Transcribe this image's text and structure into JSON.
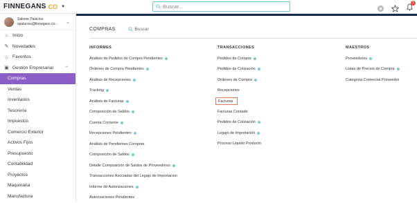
{
  "topbar": {
    "logo_text": "FINNEGANS",
    "logo_co": "CO",
    "search_placeholder": "Buscar...",
    "notifications_count": "1",
    "colors": {
      "search_border": "#6fc3d8",
      "badge": "#e74c3c"
    }
  },
  "user": {
    "name": "Salome Palacios",
    "email": "spalacios@finnegans.co..."
  },
  "sidebar": {
    "items": [
      {
        "label": "Inicio",
        "icon": "home-icon"
      },
      {
        "label": "Novedades",
        "icon": "pin-icon"
      },
      {
        "label": "Favoritos",
        "icon": "star-icon"
      },
      {
        "label": "Gestión Empresarial",
        "icon": "briefcase-icon"
      }
    ],
    "sub_items": [
      "Compras",
      "Ventas",
      "Inventarios",
      "Tesorería",
      "Impuestos",
      "Comercio Exterior",
      "Activos Fijos",
      "Presupuesto",
      "Contabilidad",
      "Proyectos",
      "Maquinaria",
      "Manufactura"
    ],
    "active": "Compras",
    "colors": {
      "active_bg": "#8b5fc7",
      "top_band": "#1b2a4a"
    }
  },
  "main": {
    "title": "COMPRAS",
    "search_label": "Buscar",
    "columns": [
      {
        "title": "INFORMES",
        "links": [
          "Análisis de Pedidos de Compra Pendientes",
          "Órdenes de Compra Pendientes",
          "Análisis de Recepciones",
          "Tracking",
          "Análisis de Facturas",
          "Composición de Saldos",
          "Cuenta Corriente",
          "Recepciones Pendientes",
          "Análisis de Pendientes Compras",
          "Composición de Saldos",
          "Detalle Composición de Saldos de Proveedores",
          "Transacciones Asociadas del Legajo de Importacion",
          "Informe de Autorizaciones",
          "Autorizaciones Pendientes"
        ],
        "info_flags": [
          true,
          true,
          true,
          true,
          true,
          true,
          true,
          true,
          false,
          true,
          true,
          false,
          true,
          false
        ]
      },
      {
        "title": "TRANSACCIONES",
        "links": [
          "Pedidos de Compra",
          "Pedidos de Cotización",
          "Ordenes de Compra",
          "Recepciones",
          "Facturas",
          "Facturas Contado",
          "Pedidos de Cotización",
          "Legajo de Importación",
          "Proceso Liquido Producto"
        ],
        "info_flags": [
          true,
          true,
          true,
          false,
          true,
          false,
          true,
          true,
          false
        ]
      },
      {
        "title": "MAESTROS",
        "links": [
          "Proveedores",
          "Listas de Precios de Compra",
          "Categoría Comercial Proveedor"
        ],
        "info_flags": [
          true,
          true,
          false
        ]
      }
    ],
    "selected_link": "Facturas",
    "colors": {
      "info_dot": "#7fc8d6",
      "selected_border": "#e07b5a"
    }
  }
}
